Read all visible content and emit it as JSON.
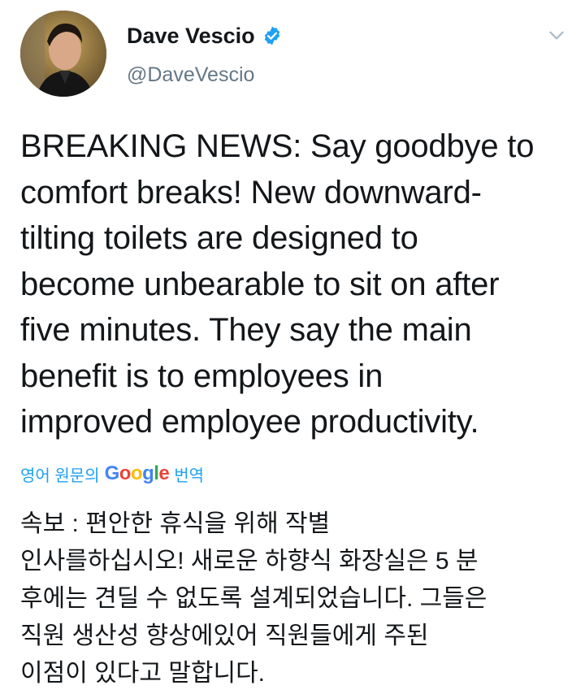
{
  "tweet": {
    "author_name": "Dave Vescio",
    "handle": "@DaveVescio",
    "text": "BREAKING NEWS: Say goodbye to comfort breaks! New downward-tilting toilets are designed to become unbearable to sit on after five minutes. They say the main benefit is to employees in improved employee productivity.",
    "text_lines": [
      "BREAKING NEWS: Say goodbye to",
      "comfort breaks! New downward-",
      "tilting toilets are designed to",
      "become unbearable to sit on after",
      "five minutes. They say the main",
      "benefit is to employees in",
      "improved employee productivity."
    ]
  },
  "translate": {
    "prefix": "영어 원문의",
    "google_letters": [
      "G",
      "o",
      "o",
      "g",
      "l",
      "e"
    ],
    "suffix": "번역"
  },
  "translation": {
    "lines": [
      "속보 : 편안한 휴식을 위해 작별",
      "인사를하십시오! 새로운 하향식 화장실은 5 분",
      "후에는 견딜 수 없도록 설계되었습니다. 그들은",
      "직원 생산성 향상에있어 직원들에게 주된",
      "이점이 있다고 말합니다."
    ]
  },
  "icons": {
    "verified": "verified-badge-icon",
    "caret": "chevron-down-icon"
  },
  "colors": {
    "verified_blue": "#1da1f2",
    "link_blue": "#1da1f2",
    "handle_gray": "#657786",
    "text": "#14171a"
  }
}
